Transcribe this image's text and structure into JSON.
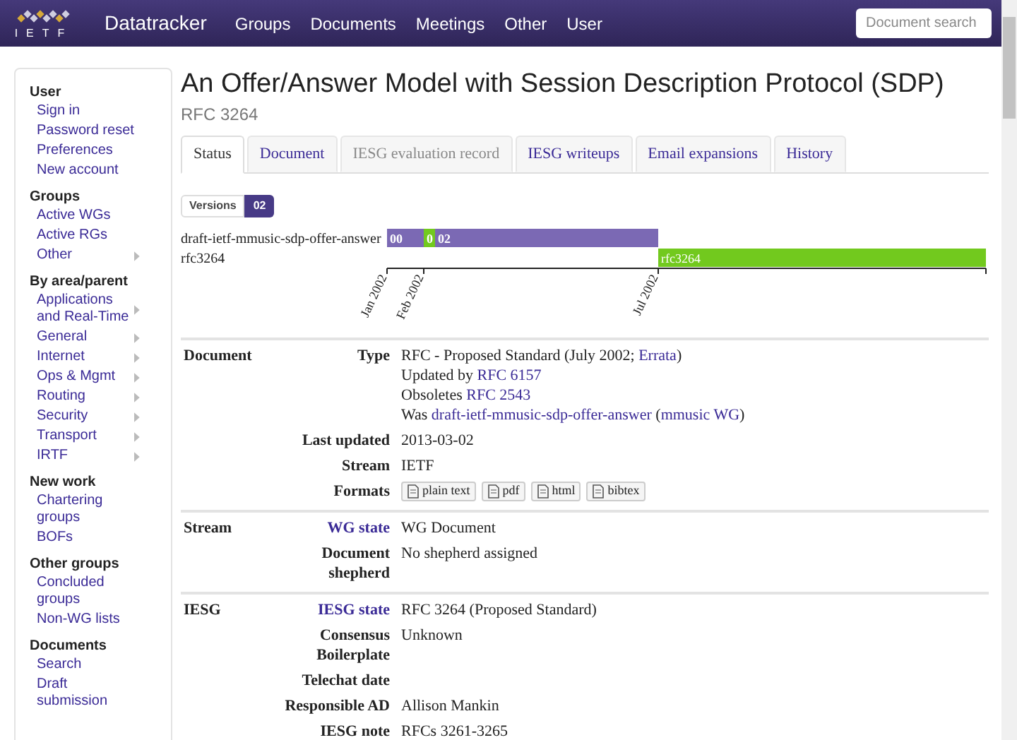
{
  "navbar": {
    "logo": "IETF",
    "brand": "Datatracker",
    "menu": [
      "Groups",
      "Documents",
      "Meetings",
      "Other",
      "User"
    ],
    "search": {
      "placeholder": "Document search"
    }
  },
  "sidebar": [
    {
      "heading": "User",
      "items": [
        {
          "label": "Sign in",
          "submenu": false
        },
        {
          "label": "Password reset",
          "submenu": false
        },
        {
          "label": "Preferences",
          "submenu": false
        },
        {
          "label": "New account",
          "submenu": false
        }
      ]
    },
    {
      "heading": "Groups",
      "items": [
        {
          "label": "Active WGs",
          "submenu": false
        },
        {
          "label": "Active RGs",
          "submenu": false
        },
        {
          "label": "Other",
          "submenu": true
        }
      ]
    },
    {
      "heading": "By area/parent",
      "items": [
        {
          "label": "Applications and Real-Time",
          "submenu": true
        },
        {
          "label": "General",
          "submenu": true
        },
        {
          "label": "Internet",
          "submenu": true
        },
        {
          "label": "Ops & Mgmt",
          "submenu": true
        },
        {
          "label": "Routing",
          "submenu": true
        },
        {
          "label": "Security",
          "submenu": true
        },
        {
          "label": "Transport",
          "submenu": true
        },
        {
          "label": "IRTF",
          "submenu": true
        }
      ]
    },
    {
      "heading": "New work",
      "items": [
        {
          "label": "Chartering groups",
          "submenu": false
        },
        {
          "label": "BOFs",
          "submenu": false
        }
      ]
    },
    {
      "heading": "Other groups",
      "items": [
        {
          "label": "Concluded groups",
          "submenu": false
        },
        {
          "label": "Non-WG lists",
          "submenu": false
        }
      ]
    },
    {
      "heading": "Documents",
      "items": [
        {
          "label": "Search",
          "submenu": false
        },
        {
          "label": "Draft submission",
          "submenu": false
        }
      ]
    }
  ],
  "title": "An Offer/Answer Model with Session Description Protocol (SDP)",
  "subtitle": "RFC 3264",
  "tabs": [
    {
      "label": "Status",
      "selected": true,
      "disabled": false
    },
    {
      "label": "Document",
      "selected": false,
      "disabled": false
    },
    {
      "label": "IESG evaluation record",
      "selected": false,
      "disabled": true
    },
    {
      "label": "IESG writeups",
      "selected": false,
      "disabled": false
    },
    {
      "label": "Email expansions",
      "selected": false,
      "disabled": false
    },
    {
      "label": "History",
      "selected": false,
      "disabled": false
    }
  ],
  "versions": {
    "label": "Versions",
    "items": [
      {
        "label": "02",
        "selected": true
      }
    ]
  },
  "timeline": {
    "rows": [
      "draft-ietf-mmusic-sdp-offer-answer",
      "rfc3264"
    ],
    "bars": [
      {
        "label": "00",
        "kind": "draft"
      },
      {
        "label": "0",
        "kind": "rfc"
      },
      {
        "label": "02",
        "kind": "draft"
      },
      {
        "label": "rfc3264",
        "kind": "rfc"
      }
    ],
    "ticks": [
      "Jan 2002",
      "Feb 2002",
      "Jul 2002"
    ]
  },
  "sections": [
    {
      "name": "Document",
      "rows": [
        {
          "key": "Type",
          "link": false,
          "lines": [
            [
              {
                "text": "RFC - Proposed Standard (July 2002; ",
                "link": false
              },
              {
                "text": "Errata",
                "link": true
              },
              {
                "text": ")",
                "link": false
              }
            ],
            [
              {
                "text": "Updated by ",
                "link": false
              },
              {
                "text": "RFC 6157",
                "link": true
              }
            ],
            [
              {
                "text": "Obsoletes ",
                "link": false
              },
              {
                "text": "RFC 2543",
                "link": true
              }
            ],
            [
              {
                "text": "Was ",
                "link": false
              },
              {
                "text": "draft-ietf-mmusic-sdp-offer-answer",
                "link": true
              },
              {
                "text": " (",
                "link": false
              },
              {
                "text": "mmusic WG",
                "link": true
              },
              {
                "text": ")",
                "link": false
              }
            ]
          ]
        },
        {
          "key": "Last updated",
          "link": false,
          "lines": [
            [
              {
                "text": "2013-03-02",
                "link": false
              }
            ]
          ]
        },
        {
          "key": "Stream",
          "link": false,
          "lines": [
            [
              {
                "text": "IETF",
                "link": false
              }
            ]
          ]
        },
        {
          "key": "Formats",
          "link": false,
          "formats": [
            "plain text",
            "pdf",
            "html",
            "bibtex"
          ]
        }
      ]
    },
    {
      "name": "Stream",
      "rows": [
        {
          "key": "WG state",
          "link": true,
          "lines": [
            [
              {
                "text": "WG Document",
                "link": false
              }
            ]
          ]
        },
        {
          "key": "Document shepherd",
          "link": false,
          "lines": [
            [
              {
                "text": "No shepherd assigned",
                "link": false
              }
            ]
          ]
        }
      ]
    },
    {
      "name": "IESG",
      "rows": [
        {
          "key": "IESG state",
          "link": true,
          "lines": [
            [
              {
                "text": "RFC 3264 (Proposed Standard)",
                "link": false
              }
            ]
          ]
        },
        {
          "key": "Consensus Boilerplate",
          "link": false,
          "lines": [
            [
              {
                "text": "Unknown",
                "link": false
              }
            ]
          ]
        },
        {
          "key": "Telechat date",
          "link": false,
          "lines": []
        },
        {
          "key": "Responsible AD",
          "link": false,
          "lines": [
            [
              {
                "text": "Allison Mankin",
                "link": false
              }
            ]
          ]
        },
        {
          "key": "IESG note",
          "link": false,
          "lines": [
            [
              {
                "text": "RFCs 3261-3265",
                "link": false
              }
            ]
          ]
        }
      ]
    }
  ]
}
